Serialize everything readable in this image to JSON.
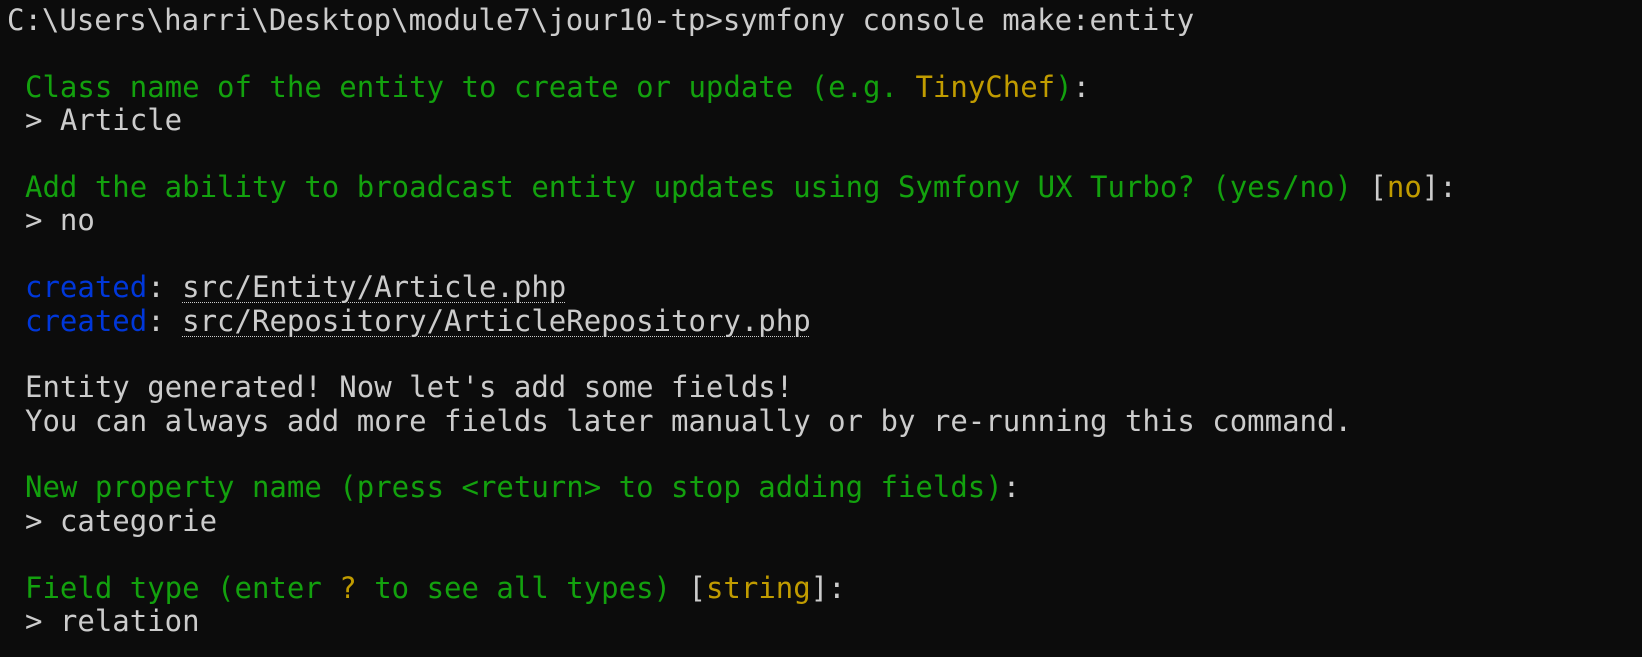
{
  "terminal": {
    "prompt_line": "C:\\Users\\harri\\Desktop\\module7\\jour10-tp>symfony console make:entity",
    "q_class": {
      "text_before": "Class name of the entity to create or update (e.g. ",
      "example": "TinyChef",
      "text_after": "):",
      "colon_white": ":",
      "close_paren": ")"
    },
    "a_class": "> Article",
    "q_turbo": {
      "text": "Add the ability to broadcast entity updates using Symfony UX Turbo? (yes/no) ",
      "bracket_open": "[",
      "default": "no",
      "bracket_close": "]:"
    },
    "a_turbo": "> no",
    "created": [
      {
        "label": "created",
        "sep": ": ",
        "path": "src/Entity/Article.php"
      },
      {
        "label": "created",
        "sep": ": ",
        "path": "src/Repository/ArticleRepository.php"
      }
    ],
    "msg1": "Entity generated! Now let's add some fields!",
    "msg2": "You can always add more fields later manually or by re-running this command.",
    "q_prop": {
      "text": "New property name (press <return> to stop adding fields)",
      "colon": ":"
    },
    "a_prop": "> categorie",
    "q_type": {
      "text_before": "Field type (enter ",
      "q_mark": "?",
      "text_after": " to see all types) ",
      "bracket_open": "[",
      "default": "string",
      "bracket_close": "]:"
    },
    "a_type": "> relation",
    "colors": {
      "background": "#0c0c0c",
      "text": "#cccccc",
      "green": "#13a10e",
      "yellow": "#c19c00",
      "blue": "#0037da"
    }
  }
}
